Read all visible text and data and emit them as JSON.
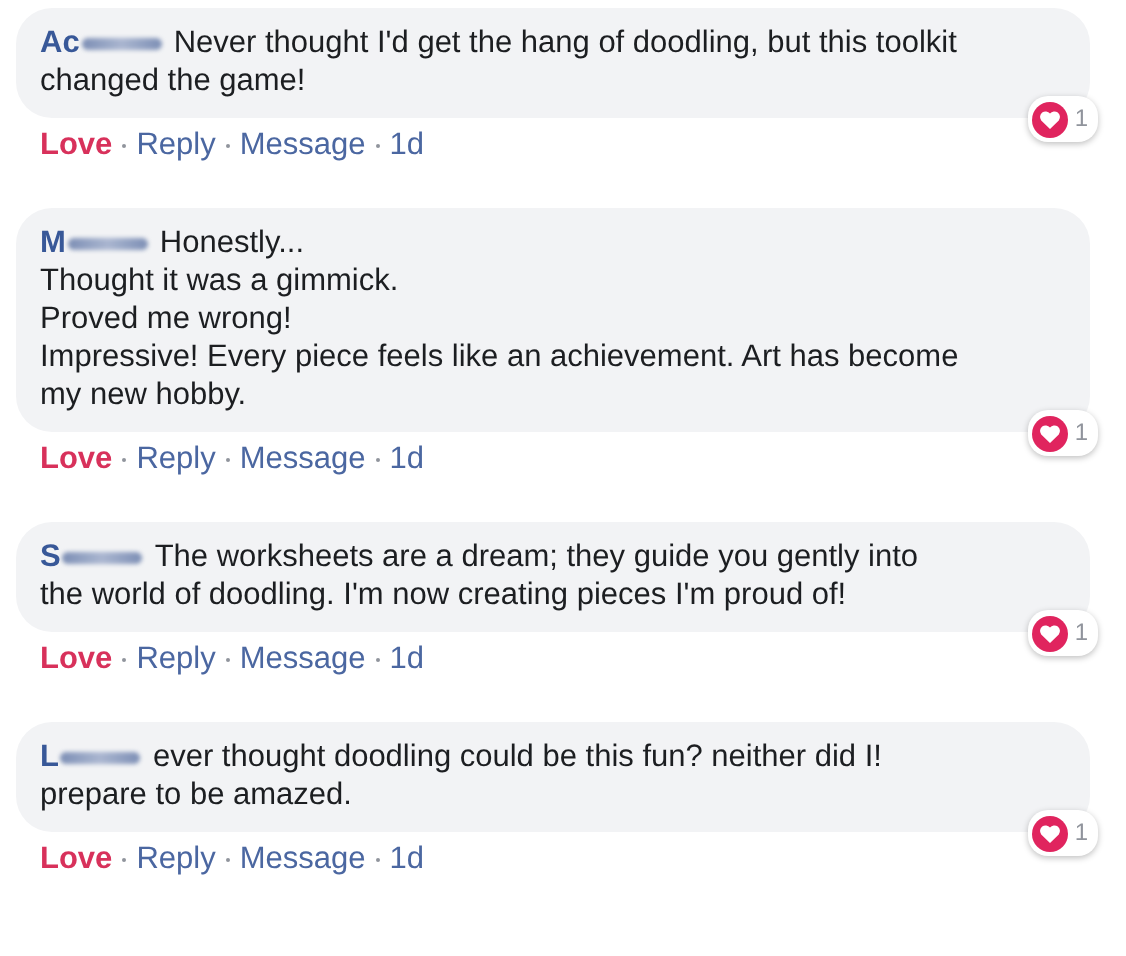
{
  "comments": [
    {
      "name": "Ac",
      "text": "Never thought I'd get the hang of doodling, but this toolkit\nchanged the game!",
      "reaction_count": "1",
      "actions": [
        {
          "label": "Love",
          "loved": true
        },
        {
          "label": "Reply",
          "loved": false
        },
        {
          "label": "Message",
          "loved": false
        }
      ],
      "time": "1d"
    },
    {
      "name": "M",
      "text": "Honestly...\nThought it was a gimmick.\nProved me wrong!\nImpressive! Every piece feels like an achievement. Art has become\nmy new hobby.",
      "reaction_count": "1",
      "actions": [
        {
          "label": "Love",
          "loved": true
        },
        {
          "label": "Reply",
          "loved": false
        },
        {
          "label": "Message",
          "loved": false
        }
      ],
      "time": "1d"
    },
    {
      "name": "S",
      "text": "The worksheets are a dream; they guide you gently into\nthe world of doodling. I'm now creating pieces I'm proud of!",
      "reaction_count": "1",
      "actions": [
        {
          "label": "Love",
          "loved": true
        },
        {
          "label": "Reply",
          "loved": false
        },
        {
          "label": "Message",
          "loved": false
        }
      ],
      "time": "1d"
    },
    {
      "name": "L",
      "text": "ever thought doodling could be this fun? neither did I!\nprepare to be amazed.",
      "reaction_count": "1",
      "actions": [
        {
          "label": "Love",
          "loved": true
        },
        {
          "label": "Reply",
          "loved": false
        },
        {
          "label": "Message",
          "loved": false
        }
      ],
      "time": "1d"
    }
  ]
}
